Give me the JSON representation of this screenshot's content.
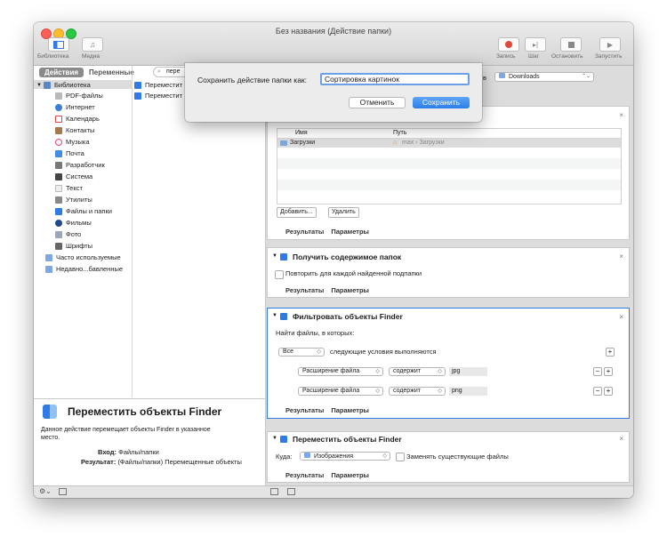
{
  "window": {
    "title": "Без названия (Действие папки)"
  },
  "toolbar": {
    "library_label": "Библиотека",
    "media_label": "Медиа",
    "record_label": "Запись",
    "step_label": "Шаг",
    "stop_label": "Остановить",
    "run_label": "Запустить"
  },
  "sidebar": {
    "tab_actions": "Действия",
    "tab_variables": "Переменные",
    "search_value": "пере",
    "items": [
      {
        "label": "Библиотека"
      },
      {
        "label": "PDF-файлы"
      },
      {
        "label": "Интернет"
      },
      {
        "label": "Календарь"
      },
      {
        "label": "Контакты"
      },
      {
        "label": "Музыка"
      },
      {
        "label": "Почта"
      },
      {
        "label": "Разработчик"
      },
      {
        "label": "Система"
      },
      {
        "label": "Текст"
      },
      {
        "label": "Утилиты"
      },
      {
        "label": "Файлы и папки"
      },
      {
        "label": "Фильмы"
      },
      {
        "label": "Фото"
      },
      {
        "label": "Шрифты"
      },
      {
        "label": "Часто используемые"
      },
      {
        "label": "Недавно...бавленные"
      }
    ],
    "results": [
      "Переместит",
      "Переместит"
    ]
  },
  "description": {
    "title": "Переместить объекты Finder",
    "text": "Данное действие перемещает объекты Finder в указанное место.",
    "input_label": "Вход:",
    "input_value": "Файлы/папки",
    "result_label": "Результат:",
    "result_value": "(Файлы/папки) Перемещенные объекты"
  },
  "workflow": {
    "folder_prefix": "в",
    "folder_value": "Downloads",
    "list_header_name": "Имя",
    "list_header_path": "Путь",
    "list_row_name": "Загрузки",
    "list_row_path": "max › Загрузки",
    "add_button": "Добавить...",
    "remove_button": "Удалить",
    "tab_results": "Результаты",
    "tab_params": "Параметры",
    "action2_title": "Получить содержимое папок",
    "action2_checkbox": "Повторить для каждой найденной подпапки",
    "action3_title": "Фильтровать объекты Finder",
    "action3_find": "Найти файлы, в которых:",
    "action3_all": "Все",
    "action3_cond": "следующие условия выполняются",
    "action3_rule1_field": "Расширение файла",
    "action3_rule1_op": "содержит",
    "action3_rule1_value": "jpg",
    "action3_rule2_field": "Расширение файла",
    "action3_rule2_op": "содержит",
    "action3_rule2_value": "png",
    "action4_title": "Переместить объекты Finder",
    "action4_to": "Куда:",
    "action4_dest": "Изображения",
    "action4_replace": "Заменять существующие файлы"
  },
  "dialog": {
    "label": "Сохранить действие папки как:",
    "value": "Сортировка картинок",
    "cancel": "Отменить",
    "save": "Сохранить"
  }
}
